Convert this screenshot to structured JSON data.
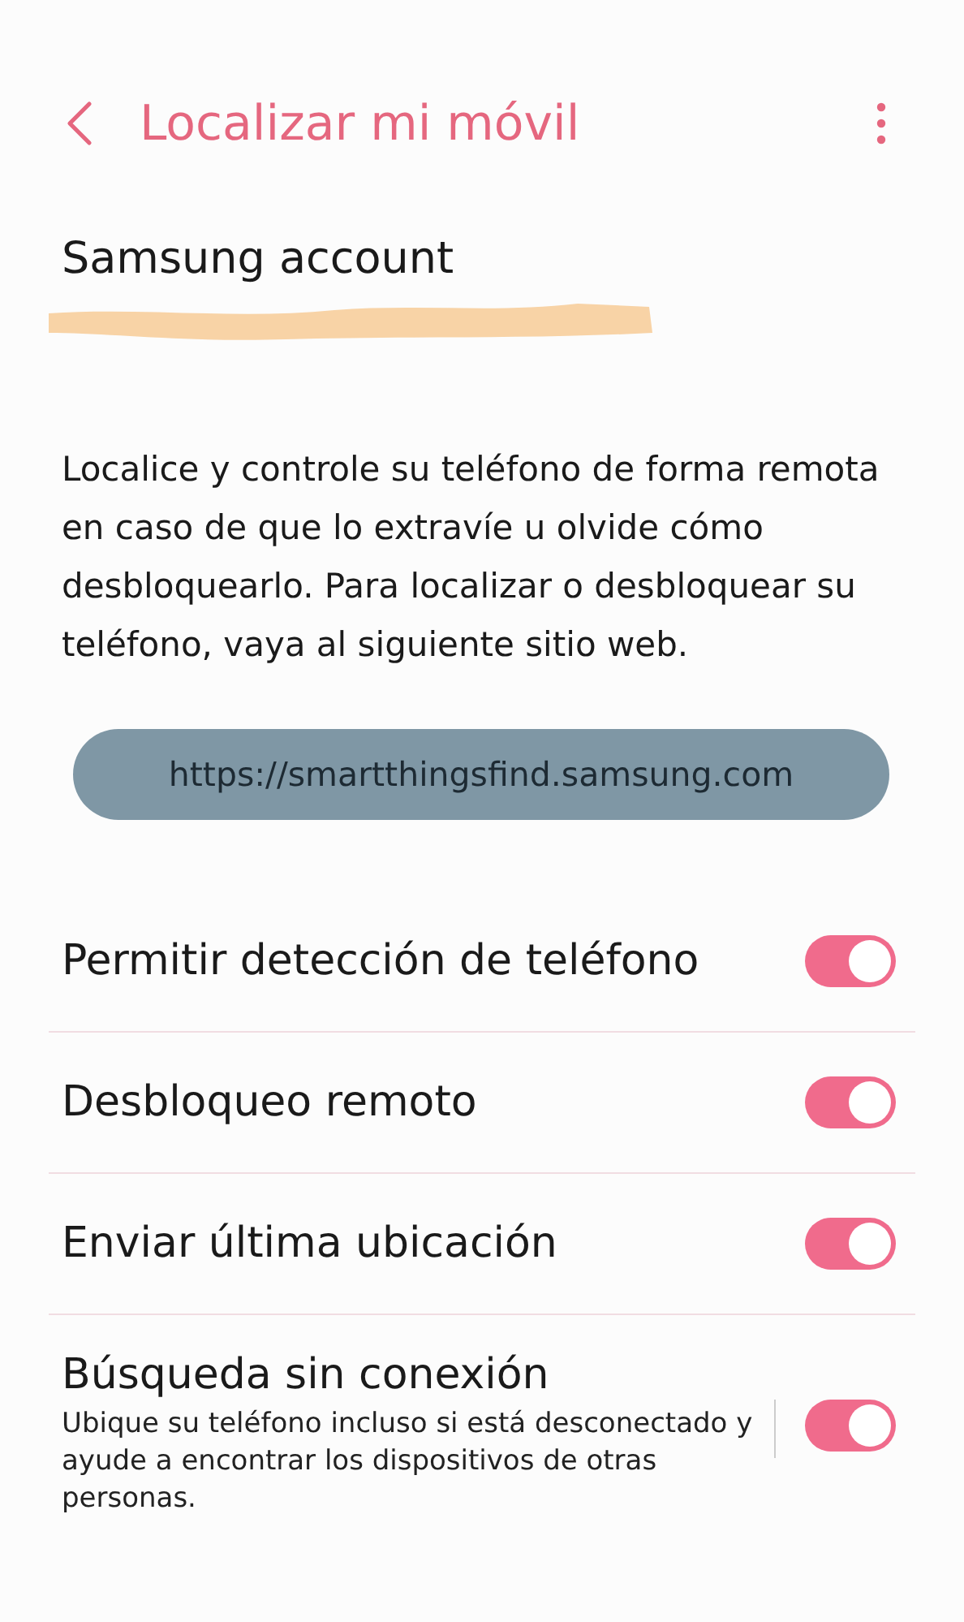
{
  "header": {
    "title": "Localizar mi móvil"
  },
  "account": {
    "label": "Samsung account"
  },
  "description": "Localice y controle su teléfono de forma remota en caso de que lo extravíe u olvide cómo desbloquearlo. Para localizar o desbloquear su teléfono, vaya al siguiente sitio web.",
  "link": "https://smartthingsfind.samsung.com",
  "settings": [
    {
      "title": "Permitir detección de teléfono",
      "on": true
    },
    {
      "title": "Desbloqueo remoto",
      "on": true
    },
    {
      "title": "Enviar última ubicación",
      "on": true
    },
    {
      "title": "Búsqueda sin conexión",
      "subtitle": "Ubique su teléfono incluso si está desconectado y ayude a encontrar los dispositivos de otras personas.",
      "on": true
    }
  ]
}
